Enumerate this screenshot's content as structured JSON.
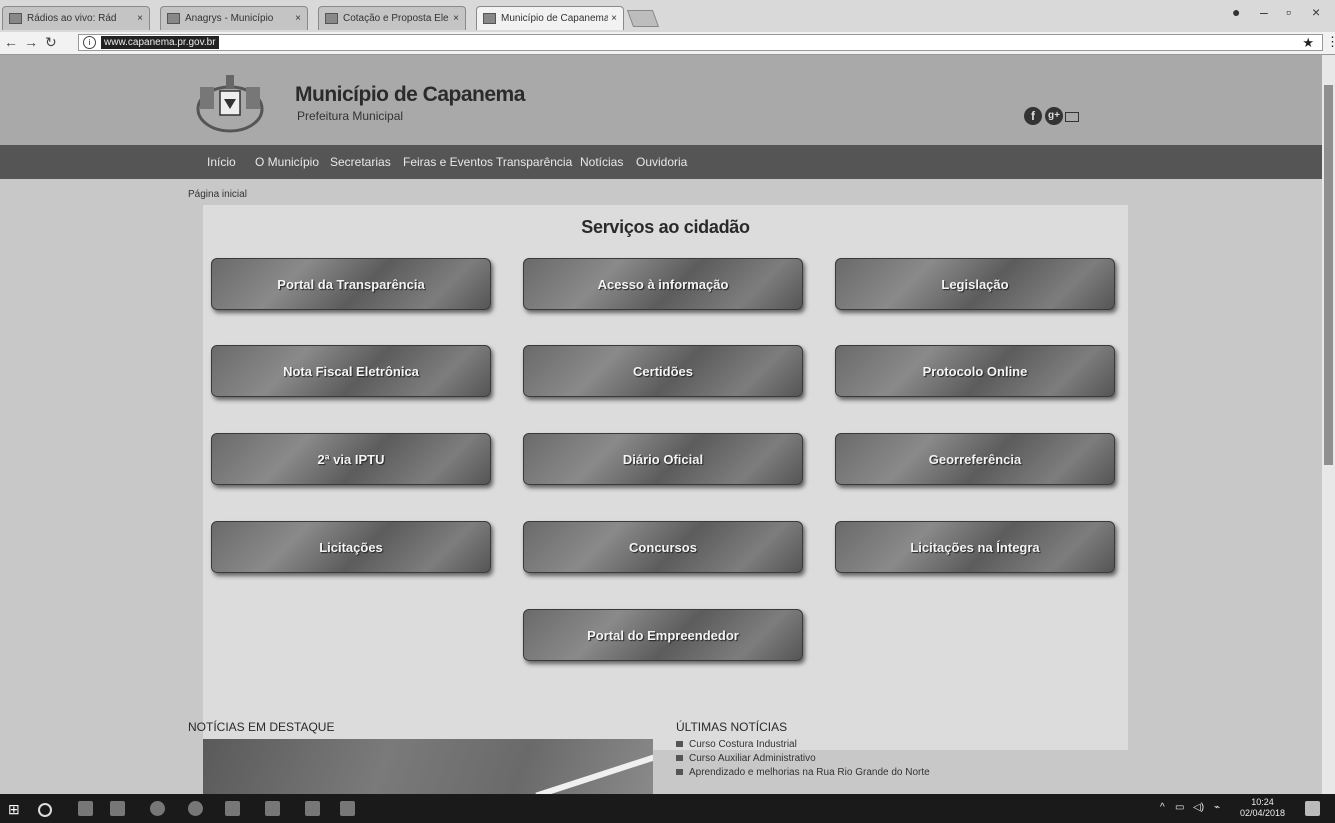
{
  "browser": {
    "tabs": [
      {
        "label": "Rádios ao vivo: Rád"
      },
      {
        "label": "Anagrys - Município"
      },
      {
        "label": "Cotação e Proposta Ele"
      },
      {
        "label": "Município de Capanema"
      }
    ],
    "url": "www.capanema.pr.gov.br"
  },
  "header": {
    "title": "Município de Capanema",
    "subtitle": "Prefeitura Municipal",
    "social": {
      "facebook": "f",
      "googleplus": "g+"
    }
  },
  "nav": {
    "items": [
      "Início",
      "O Município",
      "Secretarias",
      "Feiras e Eventos",
      "Transparência",
      "Notícias",
      "Ouvidoria"
    ]
  },
  "breadcrumb": "Página inicial",
  "services": {
    "title": "Serviços ao cidadão",
    "buttons": [
      "Portal da Transparência",
      "Acesso à informação",
      "Legislação",
      "Nota Fiscal Eletrônica",
      "Certidões",
      "Protocolo Online",
      "2ª via IPTU",
      "Diário Oficial",
      "Georreferência",
      "Licitações",
      "Concursos",
      "Licitações na Íntegra",
      "Portal do Empreendedor"
    ]
  },
  "news": {
    "featured_title": "NOTÍCIAS EM DESTAQUE",
    "latest_title": "ÚLTIMAS NOTÍCIAS",
    "latest": [
      "Curso Costura Industrial",
      "Curso Auxiliar Administrativo",
      "Aprendizado e melhorias na Rua Rio Grande do Norte"
    ]
  },
  "taskbar": {
    "time": "10:24",
    "date": "02/04/2018"
  }
}
